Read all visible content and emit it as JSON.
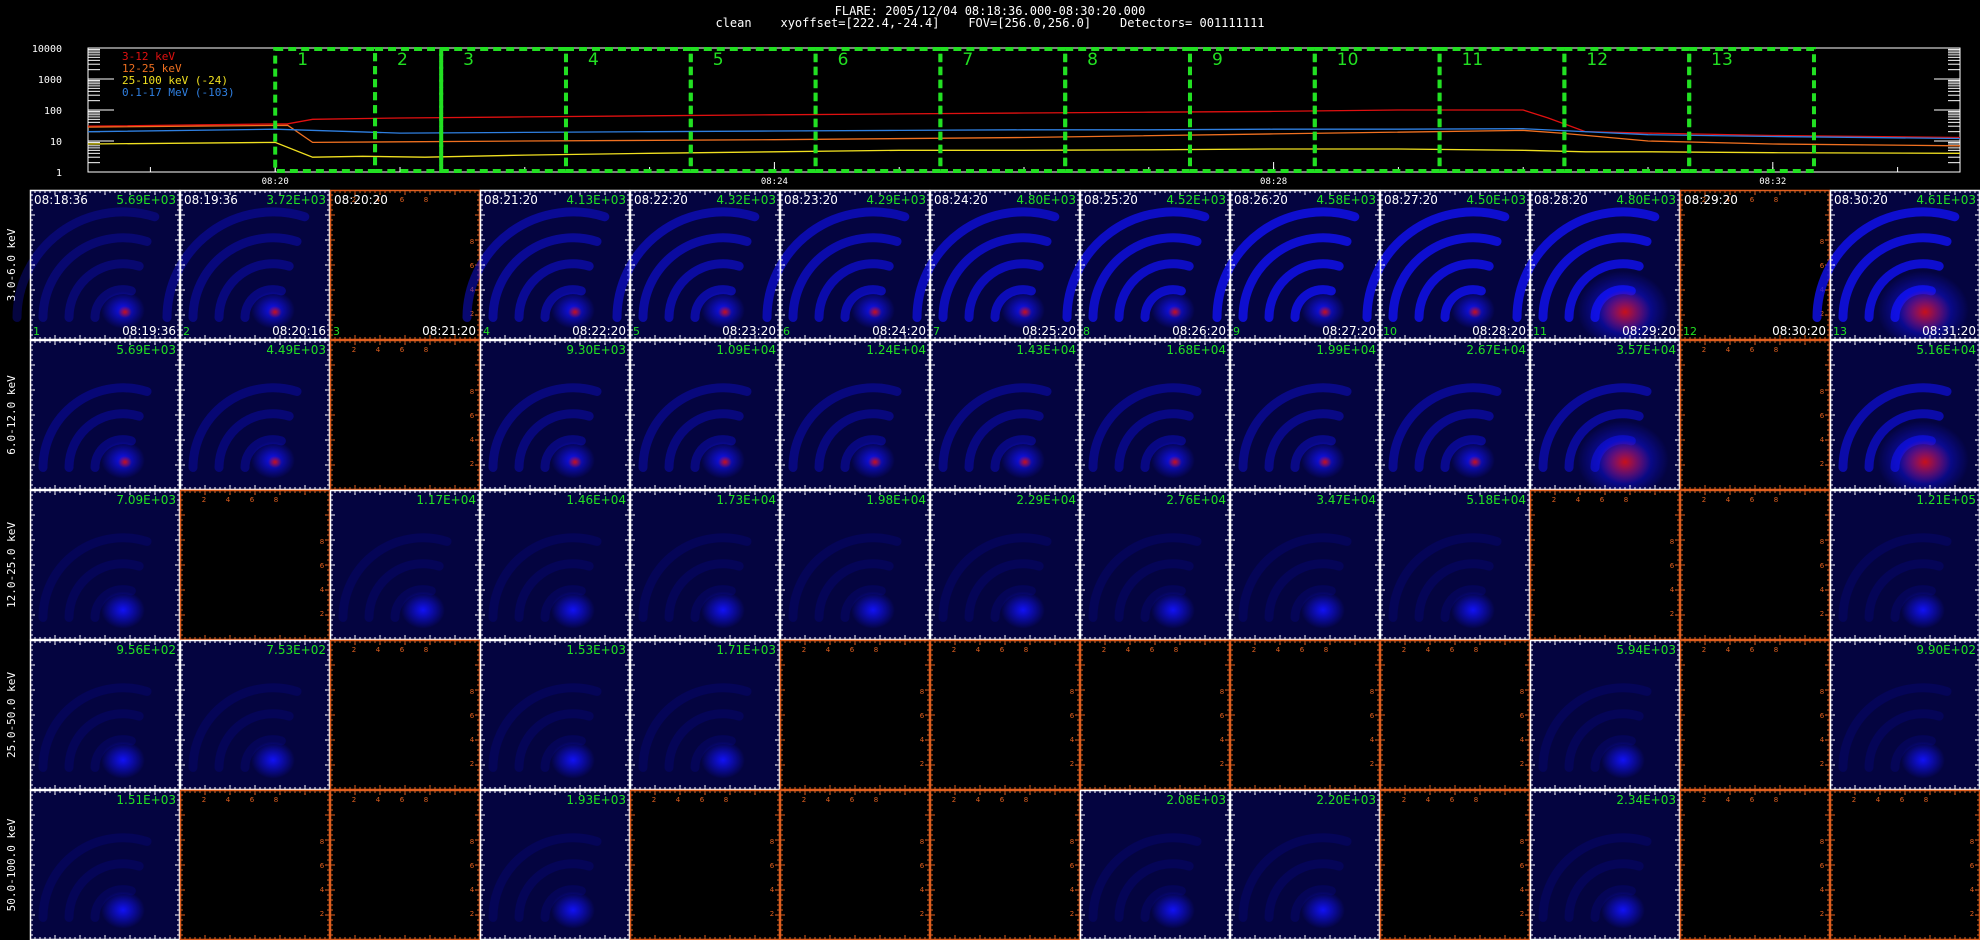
{
  "header": {
    "line1": "FLARE: 2005/12/04 08:18:36.000-08:30:20.000",
    "line2": "clean    xyoffset=[222.4,-24.4]    FOV=[256.0,256.0]    Detectors= 001111111"
  },
  "chart_data": [
    {
      "type": "line",
      "name": "lightcurve",
      "y_scale": "log",
      "ylim": [
        1,
        10000
      ],
      "y_ticklabels": [
        "10000",
        "1000",
        "100",
        "10",
        "1"
      ],
      "xlim_min": [
        18.5,
        33.5
      ],
      "x_ticklabels": [
        "08:20",
        "08:24",
        "08:28",
        "08:32"
      ],
      "legend": [
        {
          "label": "3-12 keV",
          "color": "#e01010"
        },
        {
          "label": "12-25 keV",
          "color": "#f07020"
        },
        {
          "label": "25-100 keV (-24)",
          "color": "#f0e020"
        },
        {
          "label": "0.1-17 MeV (-103)",
          "color": "#2f7fe0"
        }
      ],
      "series": [
        {
          "name": "3-12 keV",
          "color": "#e01010",
          "x": [
            18.5,
            20.1,
            20.3,
            21,
            22,
            23,
            24,
            25,
            26,
            27,
            28,
            29,
            30,
            30.2,
            30.5,
            31,
            32,
            33.5
          ],
          "y": [
            30,
            36,
            50,
            55,
            60,
            65,
            70,
            75,
            80,
            85,
            90,
            100,
            100,
            55,
            20,
            18,
            15,
            13
          ]
        },
        {
          "name": "12-25 keV",
          "color": "#f07020",
          "x": [
            18.5,
            20.1,
            20.3,
            22,
            24,
            26,
            28,
            30,
            30.3,
            31,
            32,
            33.5
          ],
          "y": [
            28,
            32,
            9,
            10,
            11,
            13,
            17,
            22,
            18,
            10,
            8,
            7
          ]
        },
        {
          "name": "25-100 keV (-24)",
          "color": "#f0e020",
          "x": [
            18.5,
            20,
            20.3,
            20.7,
            21.2,
            22,
            23,
            24,
            25,
            26,
            27,
            28,
            29,
            30,
            30.5,
            31,
            32,
            33.5
          ],
          "y": [
            8,
            9,
            3,
            3.2,
            3,
            3.5,
            4,
            4.5,
            5,
            5,
            5.2,
            5.5,
            5.5,
            5,
            4.5,
            4.5,
            4.2,
            4
          ]
        },
        {
          "name": "0.1-17 MeV (-103)",
          "color": "#2f7fe0",
          "x": [
            18.5,
            20,
            21,
            22,
            23,
            24,
            25,
            26,
            27,
            28,
            29,
            30,
            31,
            32,
            33.5
          ],
          "y": [
            20,
            24,
            18,
            19,
            20,
            21,
            22,
            23,
            23,
            24,
            24,
            25,
            16,
            14,
            12
          ]
        }
      ],
      "intervals": [
        "1",
        "2",
        "3",
        "4",
        "5",
        "6",
        "7",
        "8",
        "9",
        "10",
        "11",
        "12",
        "13"
      ],
      "interval_bounds_min": [
        20.0,
        20.8,
        21.33,
        22.33,
        23.33,
        24.33,
        25.33,
        26.33,
        27.33,
        28.33,
        29.33,
        30.33,
        31.33,
        32.33
      ]
    },
    {
      "type": "heatmap",
      "name": "image-grid",
      "colormap": [
        "#000000",
        "#1212ff",
        "#d01010"
      ],
      "energy_bands": [
        "3.0-6.0 keV",
        "6.0-12.0 keV",
        "12.0-25.0 keV",
        "25.0-50.0 keV",
        "50.0-100.0 keV"
      ],
      "intervals": [
        {
          "num": "1",
          "start": "08:18:36",
          "end": "08:19:36"
        },
        {
          "num": "2",
          "start": "08:19:36",
          "end": "08:20:16"
        },
        {
          "num": "3",
          "start": "08:20:20",
          "end": "08:21:20"
        },
        {
          "num": "4",
          "start": "08:21:20",
          "end": "08:22:20"
        },
        {
          "num": "5",
          "start": "08:22:20",
          "end": "08:23:20"
        },
        {
          "num": "6",
          "start": "08:23:20",
          "end": "08:24:20"
        },
        {
          "num": "7",
          "start": "08:24:20",
          "end": "08:25:20"
        },
        {
          "num": "8",
          "start": "08:25:20",
          "end": "08:26:20"
        },
        {
          "num": "9",
          "start": "08:26:20",
          "end": "08:27:20"
        },
        {
          "num": "10",
          "start": "08:27:20",
          "end": "08:28:20"
        },
        {
          "num": "11",
          "start": "08:28:20",
          "end": "08:29:20"
        },
        {
          "num": "12",
          "start": "08:29:20",
          "end": "08:30:20"
        },
        {
          "num": "13",
          "start": "08:30:20",
          "end": "08:31:20"
        }
      ],
      "dummy_axis_ticks": [
        "2",
        "4",
        "6",
        "8"
      ],
      "cells": [
        [
          "5.69E+03",
          "3.72E+03",
          null,
          "4.13E+03",
          "4.32E+03",
          "4.29E+03",
          "4.80E+03",
          "4.52E+03",
          "4.58E+03",
          "4.50E+03",
          "4.80E+03",
          null,
          "4.61E+03"
        ],
        [
          "5.69E+03",
          "4.49E+03",
          null,
          "9.30E+03",
          "1.09E+04",
          "1.24E+04",
          "1.43E+04",
          "1.68E+04",
          "1.99E+04",
          "2.67E+04",
          "3.57E+04",
          null,
          "5.16E+04"
        ],
        [
          "7.09E+03",
          null,
          "1.17E+04",
          "1.46E+04",
          "1.73E+04",
          "1.98E+04",
          "2.29E+04",
          "2.76E+04",
          "3.47E+04",
          "5.18E+04",
          null,
          null,
          "1.21E+05"
        ],
        [
          "9.56E+02",
          "7.53E+02",
          null,
          "1.53E+03",
          "1.71E+03",
          null,
          null,
          null,
          null,
          null,
          "5.94E+03",
          null,
          "9.90E+02"
        ],
        [
          "1.51E+03",
          null,
          null,
          "1.93E+03",
          null,
          null,
          null,
          "2.08E+03",
          "2.20E+03",
          null,
          "2.34E+03",
          null,
          null
        ]
      ]
    }
  ]
}
